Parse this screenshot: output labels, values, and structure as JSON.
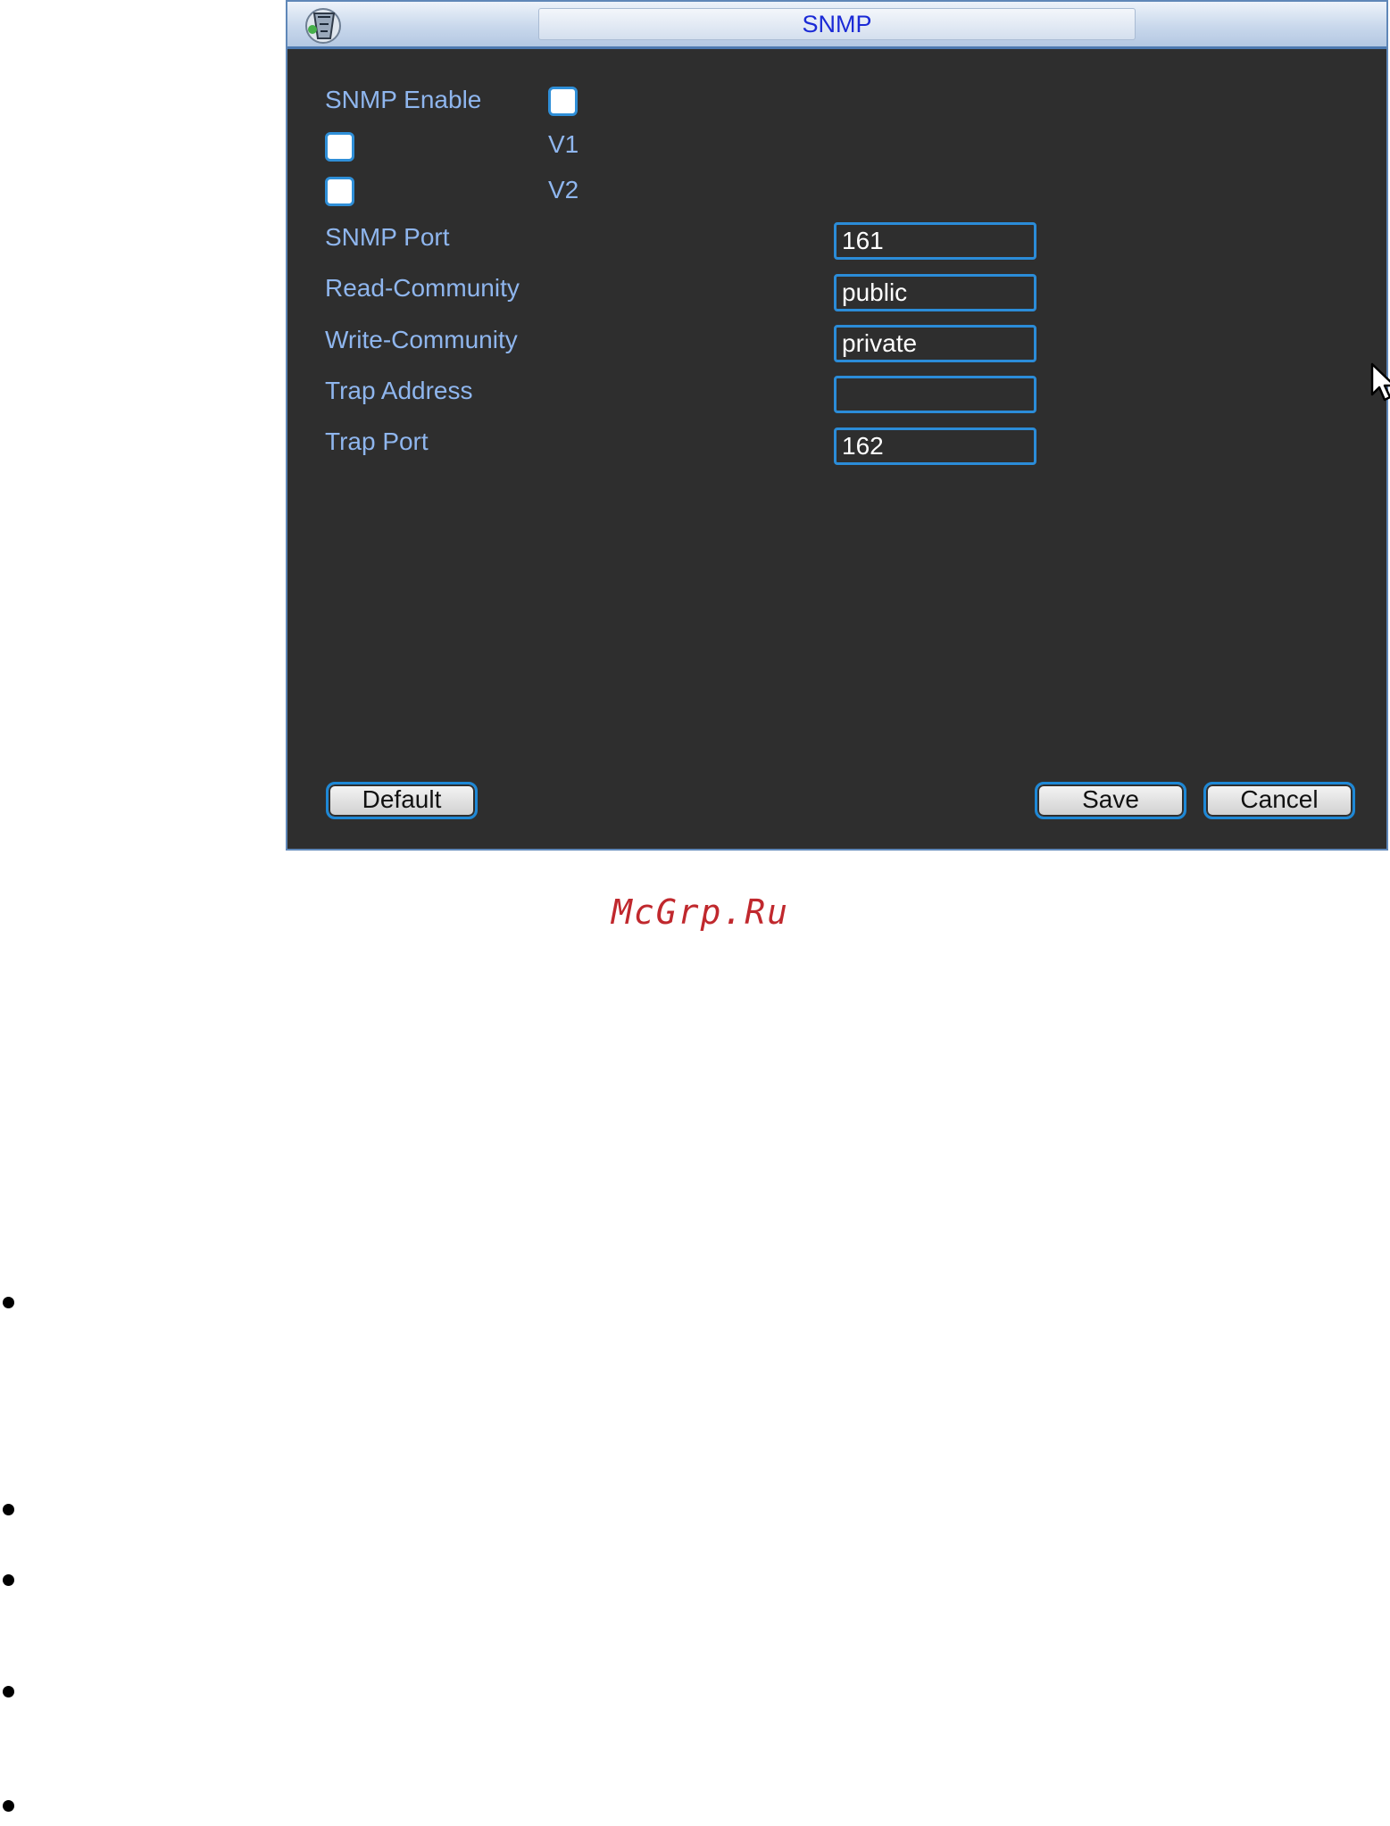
{
  "dialog": {
    "title": "SNMP",
    "fields": {
      "snmp_enable_label": "SNMP Enable",
      "v1_label": "V1",
      "v2_label": "V2",
      "snmp_port_label": "SNMP Port",
      "snmp_port_value": "161",
      "read_community_label": "Read-Community",
      "read_community_value": "public",
      "write_community_label": "Write-Community",
      "write_community_value": "private",
      "trap_address_label": "Trap Address",
      "trap_address_value": "",
      "trap_port_label": "Trap Port",
      "trap_port_value": "162"
    },
    "buttons": {
      "default": "Default",
      "save": "Save",
      "cancel": "Cancel"
    }
  },
  "watermark": "McGrp.Ru",
  "colors": {
    "dialog_bg": "#2e2e2e",
    "label": "#8fb6ee",
    "accent_border": "#2b8cd8",
    "title_text": "#1b2ad6",
    "watermark": "#c0282d"
  },
  "icons": [
    "app-logo-icon",
    "mouse-pointer-icon"
  ]
}
